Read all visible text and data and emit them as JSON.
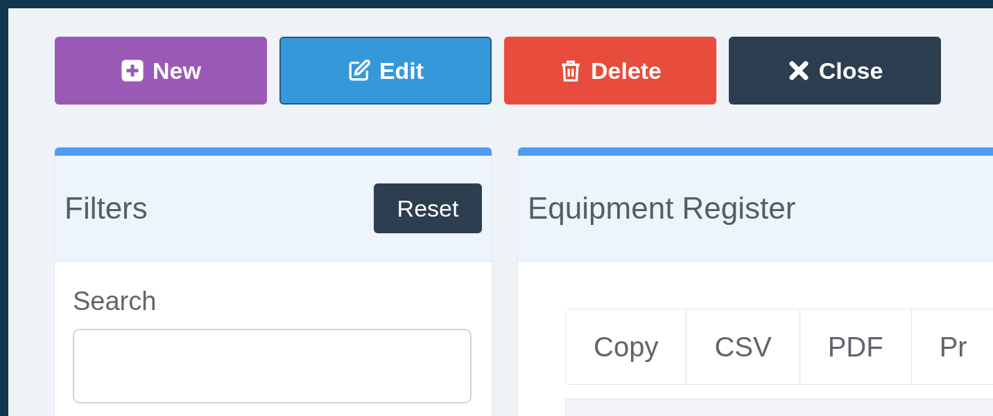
{
  "toolbar": [
    {
      "kind": "new",
      "label": "New",
      "color": "#9b59b6",
      "focused": false
    },
    {
      "kind": "edit",
      "label": "Edit",
      "color": "#3498db",
      "focused": true
    },
    {
      "kind": "delete",
      "label": "Delete",
      "color": "#e74c3c",
      "focused": false
    },
    {
      "kind": "close",
      "label": "Close",
      "color": "#2c3e50",
      "focused": false
    }
  ],
  "filters": {
    "title": "Filters",
    "reset": "Reset",
    "search_label": "Search"
  },
  "register": {
    "title": "Equipment Register",
    "export_buttons": [
      "Copy",
      "CSV",
      "PDF",
      "Pr"
    ]
  }
}
